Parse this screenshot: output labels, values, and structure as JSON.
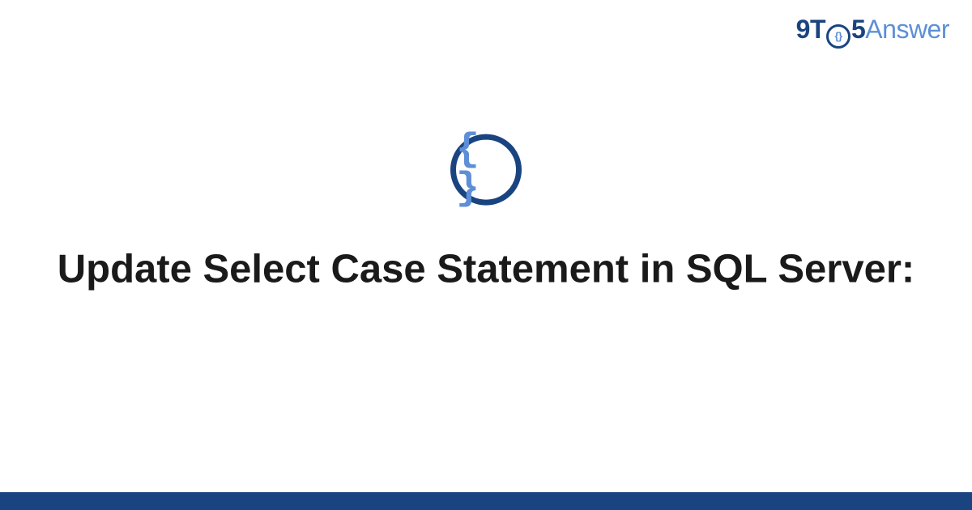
{
  "logo": {
    "part_9t": "9T",
    "part_o_inner": "{}",
    "part_5": "5",
    "part_answer": "Answer"
  },
  "badge": {
    "glyph": "{ }"
  },
  "title": "Update Select Case Statement in SQL Server:",
  "colors": {
    "brand_dark": "#1a4480",
    "brand_light": "#5d8fd6",
    "text": "#1a1a1a",
    "background": "#ffffff"
  }
}
